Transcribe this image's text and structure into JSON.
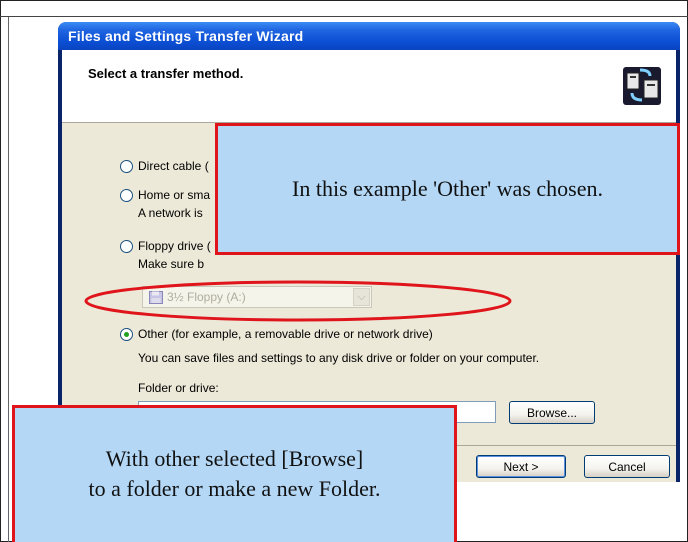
{
  "window": {
    "title": "Files and Settings Transfer Wizard",
    "header_title": "Select a transfer method.",
    "icon": "transfer-wizard-icon"
  },
  "options": {
    "direct_cable": "Direct cable (",
    "home_network": "Home or sma",
    "home_network_desc": "A network is",
    "floppy": "Floppy drive (",
    "floppy_desc": "Make sure b",
    "floppy_select_value": "3½ Floppy (A:)",
    "other": "Other (for example, a removable drive or network drive)",
    "other_desc": "You can save files and settings to any disk drive or folder on your computer."
  },
  "folder": {
    "label": "Folder or drive:",
    "value": ""
  },
  "buttons": {
    "browse": "Browse...",
    "next": "Next >",
    "cancel": "Cancel"
  },
  "callouts": {
    "top": "In this example 'Other' was chosen.",
    "bottom_line1": "With other selected [Browse]",
    "bottom_line2": "to a folder or make a new Folder."
  },
  "colors": {
    "callout_fill": "#b3d7f5",
    "callout_border": "#e0141b",
    "titlebar": "#0b4fd4"
  }
}
